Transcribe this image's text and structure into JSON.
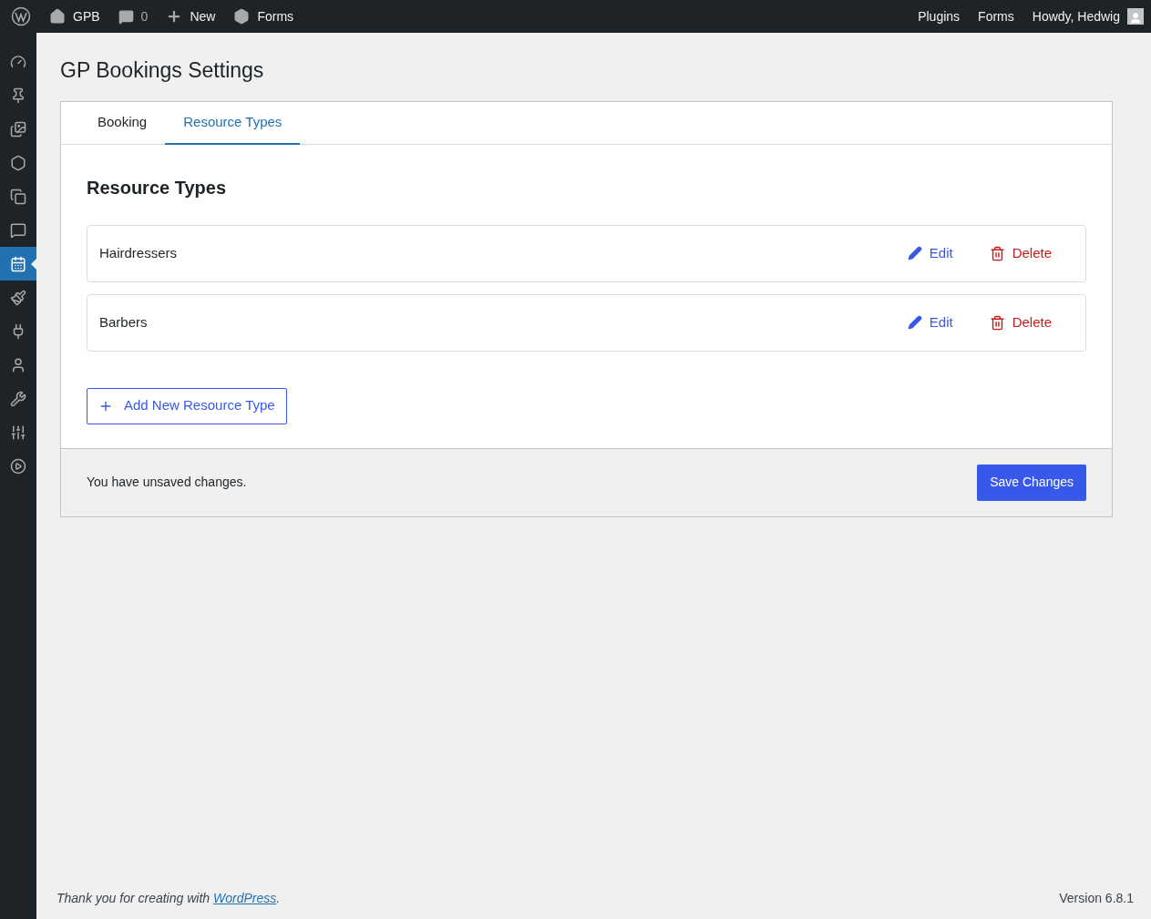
{
  "admin_bar": {
    "site": "GPB",
    "comments": "0",
    "new": "New",
    "forms": "Forms",
    "right": [
      "Plugins",
      "Forms"
    ],
    "howdy": "Howdy, Hedwig"
  },
  "sidebar": {
    "items": [
      {
        "selected": false
      },
      {
        "selected": false
      },
      {
        "selected": false
      },
      {
        "selected": false
      },
      {
        "selected": false
      },
      {
        "selected": false
      },
      {
        "selected": true
      },
      {
        "selected": false
      },
      {
        "selected": false
      },
      {
        "selected": false
      },
      {
        "selected": false
      },
      {
        "selected": false
      },
      {
        "selected": false
      }
    ]
  },
  "page_title": "GP Bookings Settings",
  "tabs": [
    {
      "label": "Booking",
      "selected": false
    },
    {
      "label": "Resource Types",
      "selected": true
    }
  ],
  "section_title": "Resource Types",
  "resource_types": [
    {
      "name": "Hairdressers",
      "edit": "Edit",
      "delete": "Delete"
    },
    {
      "name": "Barbers",
      "edit": "Edit",
      "delete": "Delete"
    }
  ],
  "add_button": "Add New Resource Type",
  "unsaved_notice": "You have unsaved changes.",
  "save_button": "Save Changes",
  "footer": {
    "text_before": "Thank you for creating with",
    "link": "WordPress",
    "text_after": ".",
    "version": "Version 6.8.1"
  }
}
